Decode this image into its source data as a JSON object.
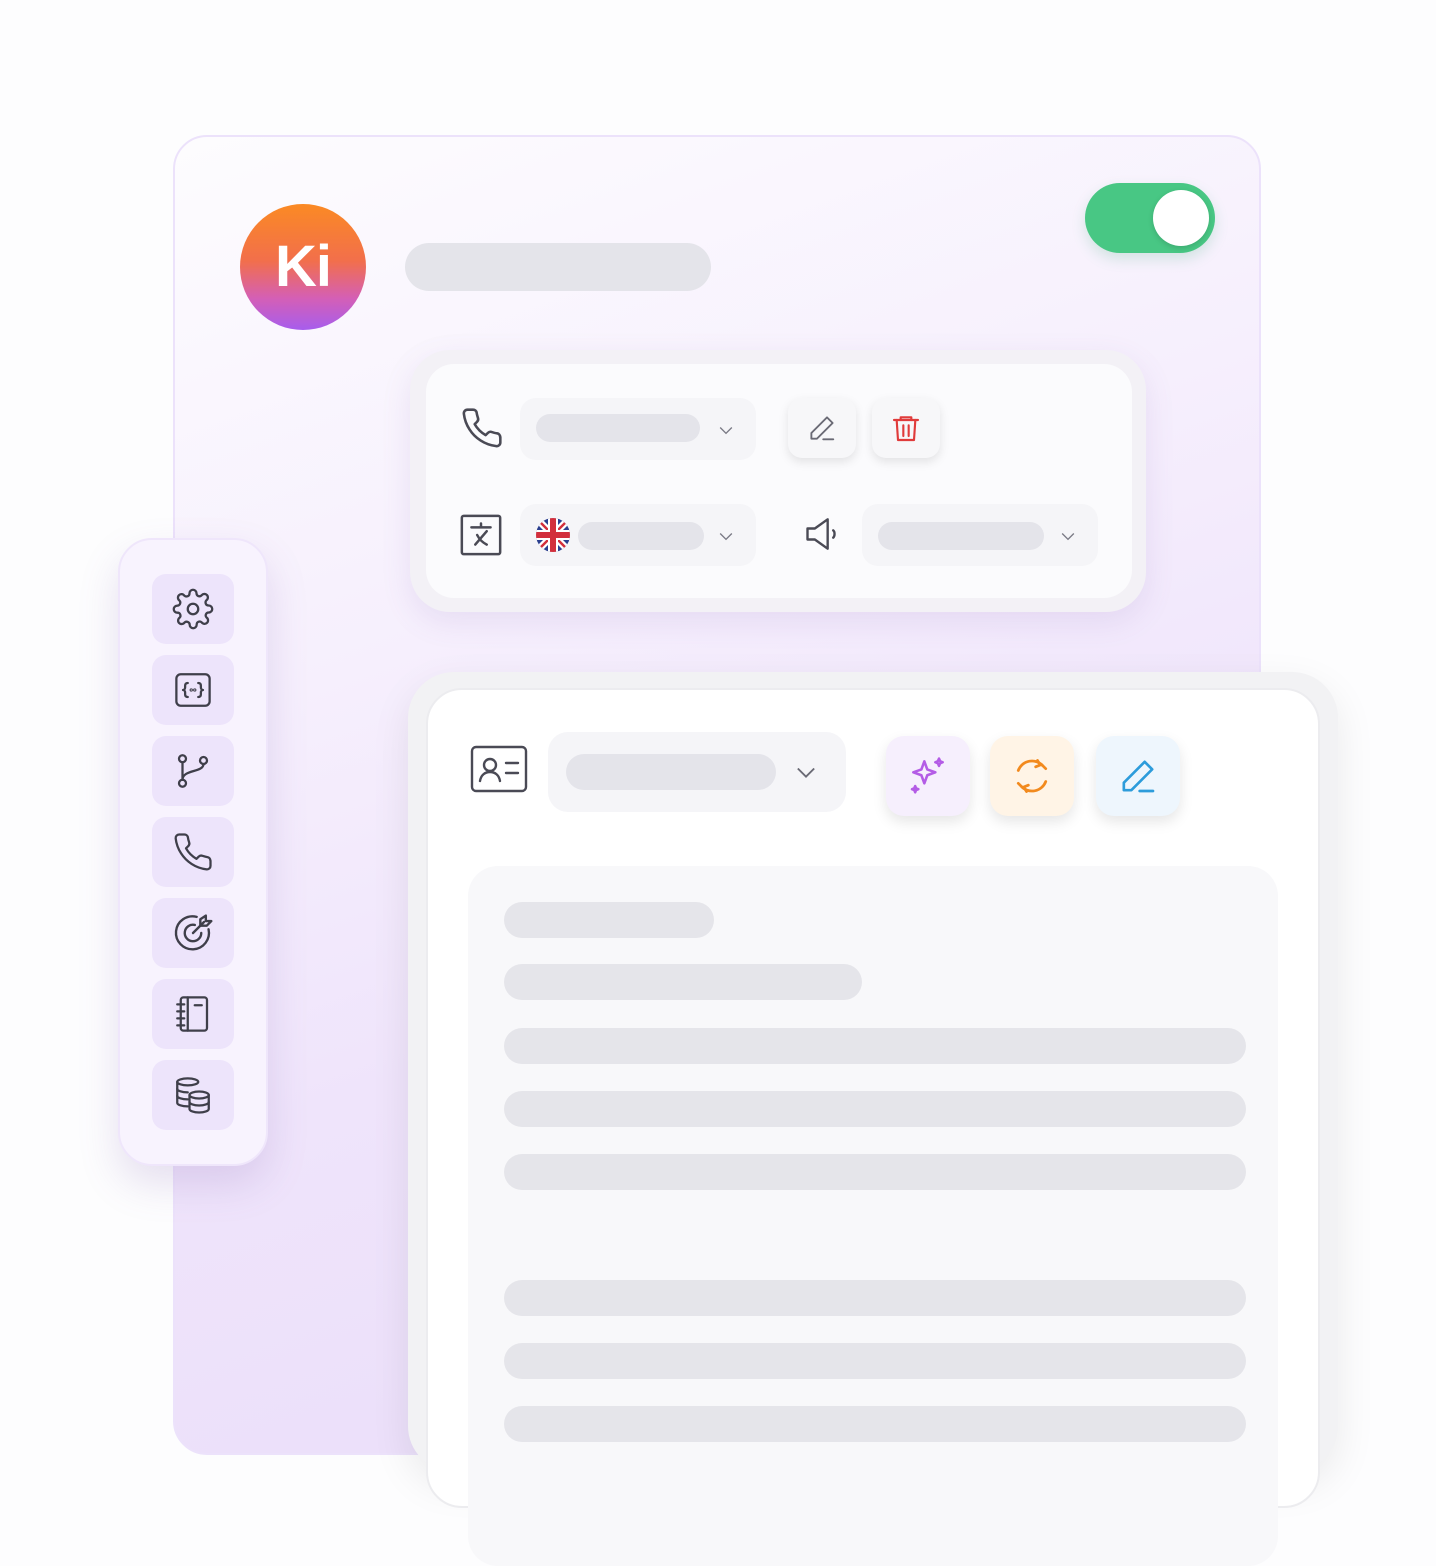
{
  "header": {
    "avatar_text": "Ki",
    "toggle_on": true
  },
  "colors": {
    "toggle_on": "#48c784",
    "delete": "#e03b3b",
    "sparkle": "#b45ce6",
    "refresh": "#f28a1e",
    "edit_blue": "#2d9cdb",
    "icon_gray": "#3f3f4a"
  },
  "settings_panel": {
    "row1": {
      "icon": "phone-icon",
      "actions": [
        "pencil-icon",
        "trash-icon"
      ]
    },
    "row2": {
      "icon": "translate-icon",
      "flag": "uk-flag-icon",
      "extra_icon": "speaker-icon"
    }
  },
  "sidebar": {
    "items": [
      {
        "icon": "gear-icon"
      },
      {
        "icon": "code-braces-icon"
      },
      {
        "icon": "git-branch-icon"
      },
      {
        "icon": "phone-icon"
      },
      {
        "icon": "target-icon"
      },
      {
        "icon": "notebook-icon"
      },
      {
        "icon": "database-icon"
      }
    ]
  },
  "main_panel": {
    "header_icon": "contact-card-icon",
    "actions": [
      "sparkle-icon",
      "refresh-icon",
      "pencil-icon"
    ]
  }
}
